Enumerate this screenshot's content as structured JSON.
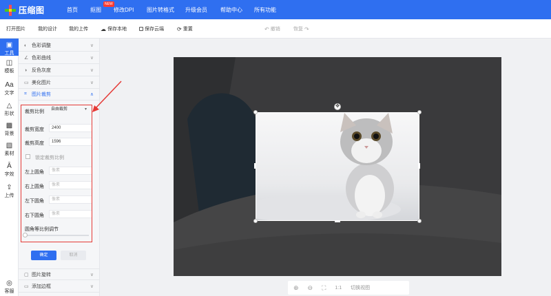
{
  "brand": {
    "name": "压缩图",
    "colors": {
      "primary": "#2f6ff0",
      "danger": "#e53935"
    }
  },
  "nav": {
    "items": [
      "首页",
      "抠图",
      "修改DPI",
      "图片转格式",
      "升级会员",
      "帮助中心",
      "所有功能"
    ],
    "badge": "NEW"
  },
  "toolbar": {
    "open_image": "打开图片",
    "my_designs": "我的设计",
    "my_uploads": "我的上传",
    "save_local": "保存本地",
    "save_cloud": "保存云端",
    "reset": "重置",
    "undo": "撤销",
    "redo": "恢复"
  },
  "rail": {
    "items": [
      {
        "label": "工具",
        "icon": "tools-icon"
      },
      {
        "label": "模板",
        "icon": "template-icon"
      },
      {
        "label": "文字",
        "icon": "text-icon"
      },
      {
        "label": "形状",
        "icon": "shape-icon"
      },
      {
        "label": "背景",
        "icon": "background-icon"
      },
      {
        "label": "素材",
        "icon": "material-icon"
      },
      {
        "label": "字效",
        "icon": "text-effect-icon"
      },
      {
        "label": "上传",
        "icon": "upload-icon"
      }
    ],
    "service": "客服"
  },
  "panel": {
    "sections": [
      "色彩调整",
      "色彩曲线",
      "反色灰度",
      "美化图片",
      "图片裁剪"
    ],
    "crop": {
      "ratio_label": "裁剪比例",
      "ratio_value": "自由裁剪",
      "width_label": "裁剪宽度",
      "width_value": "2400",
      "height_label": "裁剪高度",
      "height_value": "1596",
      "lock_label": "锁定裁剪比例",
      "corners": [
        {
          "label": "左上圆角",
          "placeholder": "像素"
        },
        {
          "label": "右上圆角",
          "placeholder": "像素"
        },
        {
          "label": "左下圆角",
          "placeholder": "像素"
        },
        {
          "label": "右下圆角",
          "placeholder": "像素"
        }
      ],
      "slider_label": "圆角等比例调节",
      "slider_value": 0,
      "confirm": "确定",
      "cancel": "取消"
    },
    "bottom_sections": [
      "图片旋转",
      "添加边框"
    ]
  },
  "zoom": {
    "one_to_one": "1:1",
    "switch_view": "切换视图"
  }
}
